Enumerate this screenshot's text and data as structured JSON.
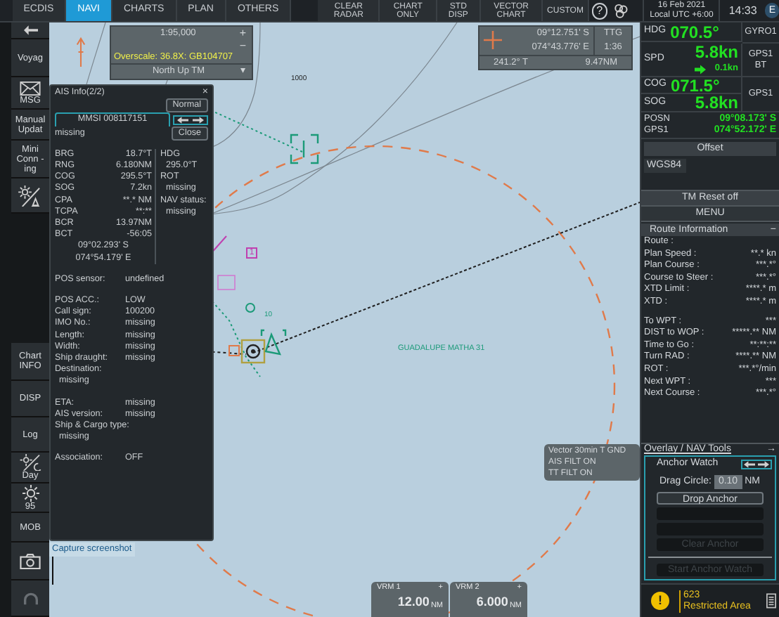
{
  "top_tabs": [
    {
      "label": "ECDIS",
      "selected": false
    },
    {
      "label": "NAVI",
      "selected": true
    },
    {
      "label": "CHARTS",
      "selected": false
    },
    {
      "label": "PLAN",
      "selected": false
    },
    {
      "label": "OTHERS",
      "selected": false
    }
  ],
  "top_buttons": [
    {
      "label": "CLEAR RADAR"
    },
    {
      "label": "CHART ONLY"
    },
    {
      "label": "STD DISP"
    },
    {
      "label": "VECTOR CHART"
    },
    {
      "label": "CUSTOM"
    }
  ],
  "help": "?",
  "date": "16 Feb 2021",
  "timezone": "Local UTC +6:00",
  "time": "14:33",
  "user_badge": "E",
  "sidebar_top": [
    {
      "kind": "back"
    },
    {
      "kind": "text",
      "label": "Voyag"
    },
    {
      "kind": "mail",
      "label": "MSG"
    },
    {
      "kind": "text",
      "label": "Manual Updat"
    },
    {
      "kind": "text",
      "label": "Mini Conn -ing"
    },
    {
      "kind": "brightness-ship"
    }
  ],
  "sidebar_bottom": [
    {
      "kind": "text",
      "label": "Chart INFO"
    },
    {
      "kind": "text",
      "label": "DISP"
    },
    {
      "kind": "text",
      "label": "Log"
    },
    {
      "kind": "day",
      "label": "Day"
    },
    {
      "kind": "brightness",
      "label": "95"
    },
    {
      "kind": "text",
      "label": "MOB"
    },
    {
      "kind": "camera"
    },
    {
      "kind": "headset"
    }
  ],
  "scale_box": {
    "scale": "1:95,000",
    "zoom_in": "+",
    "zoom_out": "−",
    "overscale": "Overscale: 36.8X: GB104707",
    "orientation": "North Up TM",
    "dropdown": "▾"
  },
  "cursor_box": {
    "lat": "09°12.751' S",
    "lon": "074°43.776' E",
    "ttg_label": "TTG",
    "ttg": "1:36",
    "bearing": "241.2° T",
    "distance": "9.47NM"
  },
  "depth_label": "1000",
  "target_name": "GUADALUPE MATHA 31",
  "target_tag": "10",
  "route_mark": "1",
  "ais_panel": {
    "title": "AIS Info(2/2)",
    "close_x": "×",
    "mode": "Normal",
    "mmsi": "MMSI 008117151",
    "name": "missing",
    "close": "Close",
    "left": [
      {
        "label": "BRG",
        "value": "18.7°T"
      },
      {
        "label": "RNG",
        "value": "6.180NM"
      },
      {
        "label": "COG",
        "value": "295.5°T"
      },
      {
        "label": "SOG",
        "value": "7.2kn"
      },
      {
        "label": "CPA",
        "value": "**.* NM"
      },
      {
        "label": "TCPA",
        "value": "**:**"
      },
      {
        "label": "BCR",
        "value": "13.97NM"
      },
      {
        "label": "BCT",
        "value": "-56:05"
      }
    ],
    "position": [
      "09°02.293' S",
      "074°54.179' E"
    ],
    "right": [
      "HDG",
      "295.0°T",
      "ROT",
      "missing",
      "NAV status:",
      "missing"
    ],
    "field_groups": [
      [
        {
          "label": "POS sensor:",
          "value": "undefined"
        }
      ],
      [
        {
          "label": "POS ACC.:",
          "value": "LOW"
        },
        {
          "label": "Call sign:",
          "value": "100200"
        },
        {
          "label": "IMO No.:",
          "value": "missing"
        },
        {
          "label": "Length:",
          "value": "missing"
        },
        {
          "label": "Width:",
          "value": "missing"
        },
        {
          "label": "Ship draught:",
          "value": "missing"
        },
        {
          "label": "Destination:",
          "value": "missing",
          "wrap": true
        }
      ],
      [
        {
          "label": "ETA:",
          "value": "missing"
        },
        {
          "label": "AIS version:",
          "value": "missing"
        },
        {
          "label": "Ship & Cargo type:",
          "value": "missing",
          "wrap": true
        }
      ],
      [
        {
          "label": "Association:",
          "value": "OFF"
        }
      ]
    ]
  },
  "capture_label": "Capture screenshot",
  "vector_box": [
    "Vector 30min T GND",
    "AIS FILT ON",
    "TT FILT ON"
  ],
  "vrm": [
    {
      "label": "VRM 1",
      "add": "+",
      "value": "12.00",
      "unit": "NM"
    },
    {
      "label": "VRM 2",
      "add": "+",
      "value": "6.000",
      "unit": "NM"
    }
  ],
  "nav_data": {
    "hdg": {
      "label": "HDG",
      "value": "070.5°",
      "source": "GYRO1"
    },
    "spd": {
      "label": "SPD",
      "value": "5.8kn",
      "drift": "0.1kn",
      "source": "GPS1 BT"
    },
    "cog": {
      "label": "COG",
      "value": "071.5°"
    },
    "sog": {
      "label": "SOG",
      "value": "5.8kn"
    },
    "cog_sog_source": "GPS1",
    "posn": {
      "label": "POSN",
      "source": "GPS1",
      "lat": "09°08.173' S",
      "lon": "074°52.172' E"
    }
  },
  "offset_label": "Offset",
  "datum": "WGS84",
  "tm_reset": "TM Reset off",
  "menu": "MENU",
  "route_info": {
    "title": "Route Information",
    "collapse": "−",
    "fields": [
      {
        "label": "Route :"
      },
      {
        "label": "Plan Speed :",
        "value": "**.* kn"
      },
      {
        "label": "Plan Course :",
        "value": "***.*°"
      },
      {
        "label": "Course to Steer :",
        "value": "***.*°"
      },
      {
        "label": "XTD Limit :",
        "value": "****.* m"
      },
      {
        "label": "XTD :",
        "value": "****.* m"
      }
    ],
    "target_fields": [
      {
        "label": "To WPT :",
        "value": "***"
      },
      {
        "label": "DIST to WOP :",
        "value": "*****.** NM"
      },
      {
        "label": "Time to Go :",
        "value": "**:**:**"
      },
      {
        "label": "Turn RAD :",
        "value": "****.** NM"
      },
      {
        "label": "ROT :",
        "value": "***.*°/min"
      },
      {
        "label": "Next WPT :",
        "value": "***"
      },
      {
        "label": "Next Course :",
        "value": "***.*°"
      }
    ]
  },
  "overlay_tools": {
    "title": "Overlay / NAV Tools",
    "arrow": "→",
    "section": "Anchor Watch",
    "drag_label": "Drag Circle:",
    "drag_value": "0.10",
    "drag_unit": "NM",
    "buttons": [
      {
        "label": "Drop Anchor",
        "disabled": false
      },
      {
        "disabled": true
      },
      {
        "disabled": true
      },
      {
        "label": "Clear Anchor",
        "disabled": true
      }
    ],
    "watch_button": {
      "label": "Start Anchor Watch",
      "disabled": true
    }
  },
  "alert": {
    "icon": "!",
    "code": "623",
    "message": "Restricted Area"
  }
}
